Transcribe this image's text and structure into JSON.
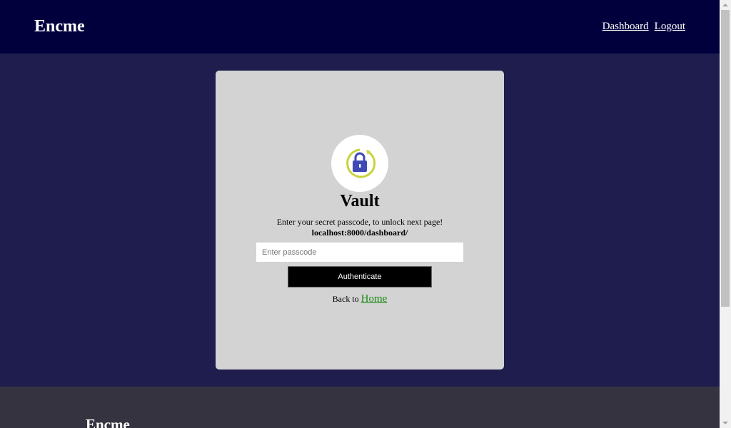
{
  "header": {
    "brand": "Encme",
    "nav": [
      {
        "label": "Dashboard"
      },
      {
        "label": "Logout"
      }
    ]
  },
  "vault": {
    "icon": "lock-refresh-icon",
    "title": "Vault",
    "instruction": "Enter your secret passcode, to unlock next page!",
    "url": "localhost:8000/dashboard/",
    "passcode_placeholder": "Enter passcode",
    "passcode_value": "",
    "button_label": "Authenticate",
    "back_prefix": "Back to",
    "back_link": "Home"
  },
  "footer": {
    "brand": "Encme"
  },
  "colors": {
    "header_bg": "#01003d",
    "main_bg": "#1e1d4e",
    "card_bg": "#d3d3d3",
    "footer_bg": "#34333f",
    "link_green": "#1d8a17",
    "lock_blue": "#3f48b5",
    "ring_yellow": "#c8d23a"
  }
}
